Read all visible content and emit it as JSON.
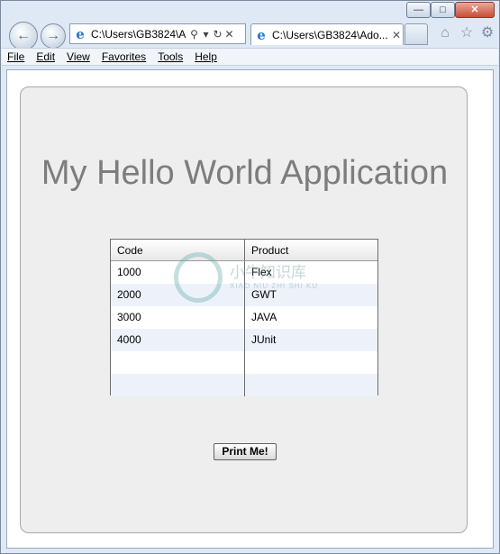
{
  "browser": {
    "address": "C:\\Users\\GB3824\\A",
    "tab_title": "C:\\Users\\GB3824\\Ado...",
    "window_controls": {
      "minimize": "—",
      "maximize": "□",
      "close": "✕"
    },
    "icons": [
      "back-icon",
      "forward-icon",
      "ie-icon",
      "search-icon",
      "refresh-icon",
      "stop-icon",
      "home-icon",
      "favorites-star-icon",
      "settings-gear-icon"
    ]
  },
  "menubar": {
    "items": [
      {
        "label": "File"
      },
      {
        "label": "Edit"
      },
      {
        "label": "View"
      },
      {
        "label": "Favorites"
      },
      {
        "label": "Tools"
      },
      {
        "label": "Help"
      }
    ]
  },
  "app": {
    "title": "My Hello World Application",
    "grid": {
      "headers": {
        "code": "Code",
        "product": "Product"
      },
      "rows": [
        {
          "code": "1000",
          "product": "Flex"
        },
        {
          "code": "2000",
          "product": "GWT"
        },
        {
          "code": "3000",
          "product": "JAVA"
        },
        {
          "code": "4000",
          "product": "JUnit"
        },
        {
          "code": "",
          "product": ""
        },
        {
          "code": "",
          "product": ""
        }
      ]
    },
    "print_button": "Print Me!",
    "watermark": {
      "text": "小牛知识库",
      "sub": "XIAO NIU ZHI SHI KU"
    }
  }
}
